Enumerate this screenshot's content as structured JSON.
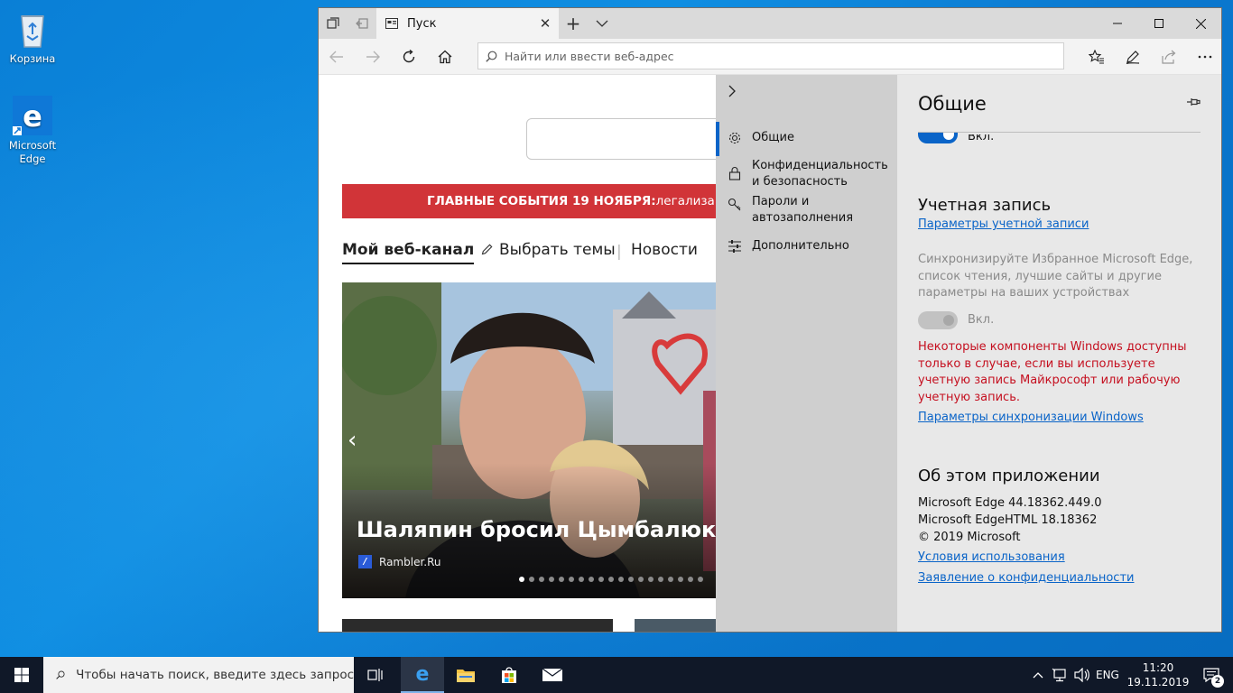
{
  "desktop": {
    "icons": [
      {
        "label": "Корзина"
      },
      {
        "label": "Microsoft Edge"
      }
    ]
  },
  "browser": {
    "tab": {
      "title": "Пуск"
    },
    "address": {
      "placeholder": "Найти или ввести веб-адрес"
    },
    "page": {
      "banner_bold": "ГЛАВНЫЕ СОБЫТИЯ 19 НОЯБРЯ:",
      "banner_rest": " легализация",
      "feed_tabs": [
        "Мой веб-канал",
        "Выбрать темы",
        "Новости"
      ],
      "hero": {
        "title": "Шаляпин бросил Цымбалюк-Р",
        "source": "Rambler.Ru",
        "slide_index": 1,
        "slide_count": 19
      }
    }
  },
  "settings_nav": {
    "items": [
      {
        "label": "Общие",
        "icon": "gear-icon"
      },
      {
        "label": "Конфиденциальность и безопасность",
        "icon": "lock-icon"
      },
      {
        "label": "Пароли и автозаполнения",
        "icon": "key-icon"
      },
      {
        "label": "Дополнительно",
        "icon": "sliders-icon"
      }
    ]
  },
  "settings": {
    "title": "Общие",
    "top_toggle_label": "Вкл.",
    "account": {
      "heading": "Учетная запись",
      "link": "Параметры учетной записи",
      "sync_text": "Синхронизируйте Избранное Microsoft Edge, список чтения, лучшие сайты и другие параметры на ваших устройствах",
      "sync_toggle_label": "Вкл.",
      "warning": "Некоторые компоненты Windows доступны только в случае, если вы используете учетную запись Майкрософт или рабочую учетную запись.",
      "sync_link": "Параметры синхронизации Windows"
    },
    "about": {
      "heading": "Об этом приложении",
      "lines": [
        "Microsoft Edge 44.18362.449.0",
        "Microsoft EdgeHTML 18.18362",
        "© 2019 Microsoft"
      ],
      "terms_link": "Условия использования",
      "privacy_link": "Заявление о конфиденциальности"
    }
  },
  "taskbar": {
    "search_placeholder": "Чтобы начать поиск, введите здесь запрос",
    "language": "ENG",
    "time": "11:20",
    "date": "19.11.2019",
    "notification_count": "2"
  },
  "colors": {
    "accent": "#0a64c8",
    "banner": "#d13438",
    "warning": "#c50f1f"
  }
}
